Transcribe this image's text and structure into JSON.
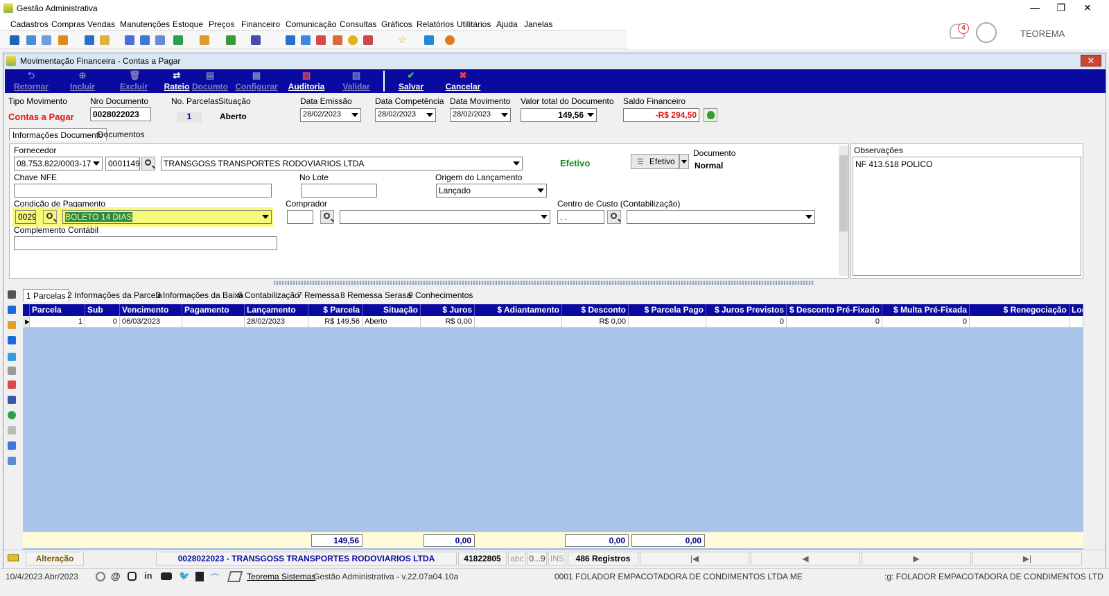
{
  "window": {
    "title": "Gestão Administrativa"
  },
  "menu": [
    "Cadastros",
    "Compras",
    "Vendas",
    "Manutenções",
    "Estoque",
    "Preços",
    "Financeiro",
    "Comunicação",
    "Consultas",
    "Gráficos",
    "Relatórios",
    "Utilitários",
    "Ajuda",
    "Janelas"
  ],
  "header_right": {
    "notification_count": "4",
    "company": "TEOREMA"
  },
  "child": {
    "title": "Movimentação Financeira - Contas a Pagar"
  },
  "actions": {
    "retornar": "Retornar",
    "incluir": "Incluir",
    "excluir": "Excluir",
    "rateio": "Rateio",
    "documento": "Documto",
    "configurar": "Configurar",
    "auditoria": "Auditoria",
    "validar": "Validar",
    "salvar": "Salvar",
    "cancelar": "Cancelar"
  },
  "header_fields": {
    "tipo_label": "Tipo Movimento",
    "tipo_value": "Contas a Pagar",
    "nro_label": "Nro Documento",
    "nro_value": "0028022023",
    "parcelas_label": "No. Parcelas",
    "parcelas_value": "1",
    "situacao_label": "Situação",
    "situacao_value": "Aberto",
    "emissao_label": "Data Emissão",
    "emissao_value": "28/02/2023",
    "competencia_label": "Data Competência",
    "competencia_value": "28/02/2023",
    "movimento_label": "Data Movimento",
    "movimento_value": "28/02/2023",
    "valor_label": "Valor total do Documento",
    "valor_value": "149,56",
    "saldo_label": "Saldo Financeiro",
    "saldo_value": "-R$ 294,50"
  },
  "doc_tabs": [
    "Informações Documento",
    "Documentos"
  ],
  "form": {
    "fornecedor_label": "Fornecedor",
    "cnpj": "08.753.822/0003-17",
    "codigo": "0001149",
    "fornecedor_nome": "TRANSGOSS TRANSPORTES RODOVIARIOS LTDA",
    "status_efetivo": "Efetivo",
    "efetivo_button": "Efetivo",
    "documento_label": "Documento",
    "documento_value": "Normal",
    "chave_label": "Chave NFE",
    "chave_value": "",
    "lote_label": "No Lote",
    "lote_value": "",
    "origem_label": "Origem do Lançamento",
    "origem_value": "Lançado",
    "condicao_label": "Condição de Pagamento",
    "condicao_codigo": "0029",
    "condicao_value": "BOLETO 14 DIAS",
    "comprador_label": "Comprador",
    "comprador_codigo": "",
    "comprador_value": "",
    "centro_label": "Centro de Custo (Contabilização)",
    "centro_codigo": " .  .",
    "centro_value": "",
    "complemento_label": "Complemento Contábil",
    "complemento_value": ""
  },
  "observacoes": {
    "label": "Observações",
    "text": "NF 413.518 POLICO"
  },
  "detail_tabs": [
    "1 Parcelas",
    "2 Informações da Parcela",
    "3 Informações da Baixa",
    "6 Contabilização",
    "7 Remessa",
    "8 Remessa Serasa",
    "9 Conhecimentos"
  ],
  "grid": {
    "columns": [
      "Parcela",
      "Sub",
      "Vencimento",
      "Pagamento",
      "Lançamento",
      "$ Parcela",
      "Situação",
      "$ Juros",
      "$ Adiantamento",
      "$ Desconto",
      "$ Parcela Pago",
      "$ Juros Previstos",
      "$ Desconto Pré-Fixado",
      "$ Multa Pré-Fixada",
      "$ Renegociação",
      "Loc"
    ],
    "rows": [
      [
        "1",
        "0",
        "06/03/2023",
        "",
        "28/02/2023",
        "R$ 149,56",
        "Aberto",
        "R$ 0,00",
        "",
        "R$ 0,00",
        "",
        "0",
        "0",
        "0",
        "",
        ""
      ]
    ],
    "totals": {
      "parcela": "149,56",
      "juros": "0,00",
      "desconto": "0,00",
      "parcela_pago": "0,00"
    }
  },
  "status": {
    "mode": "Alteração",
    "record": "0028022023 - TRANSGOSS TRANSPORTES RODOVIARIOS LTDA",
    "id": "41822805",
    "abc": "abc",
    "num": "0...9",
    "ins": "INS",
    "registros": "486 Registros"
  },
  "footer": {
    "date": "10/4/2023 Abr/2023",
    "vendor": "Teorema Sistemas",
    "version": "Gestão Administrativa - v.22.07a04.10a",
    "company": "0001 FOLADOR EMPACOTADORA DE CONDIMENTOS LTDA ME",
    "company_right": ":g: FOLADOR EMPACOTADORA DE CONDIMENTOS LTD"
  }
}
